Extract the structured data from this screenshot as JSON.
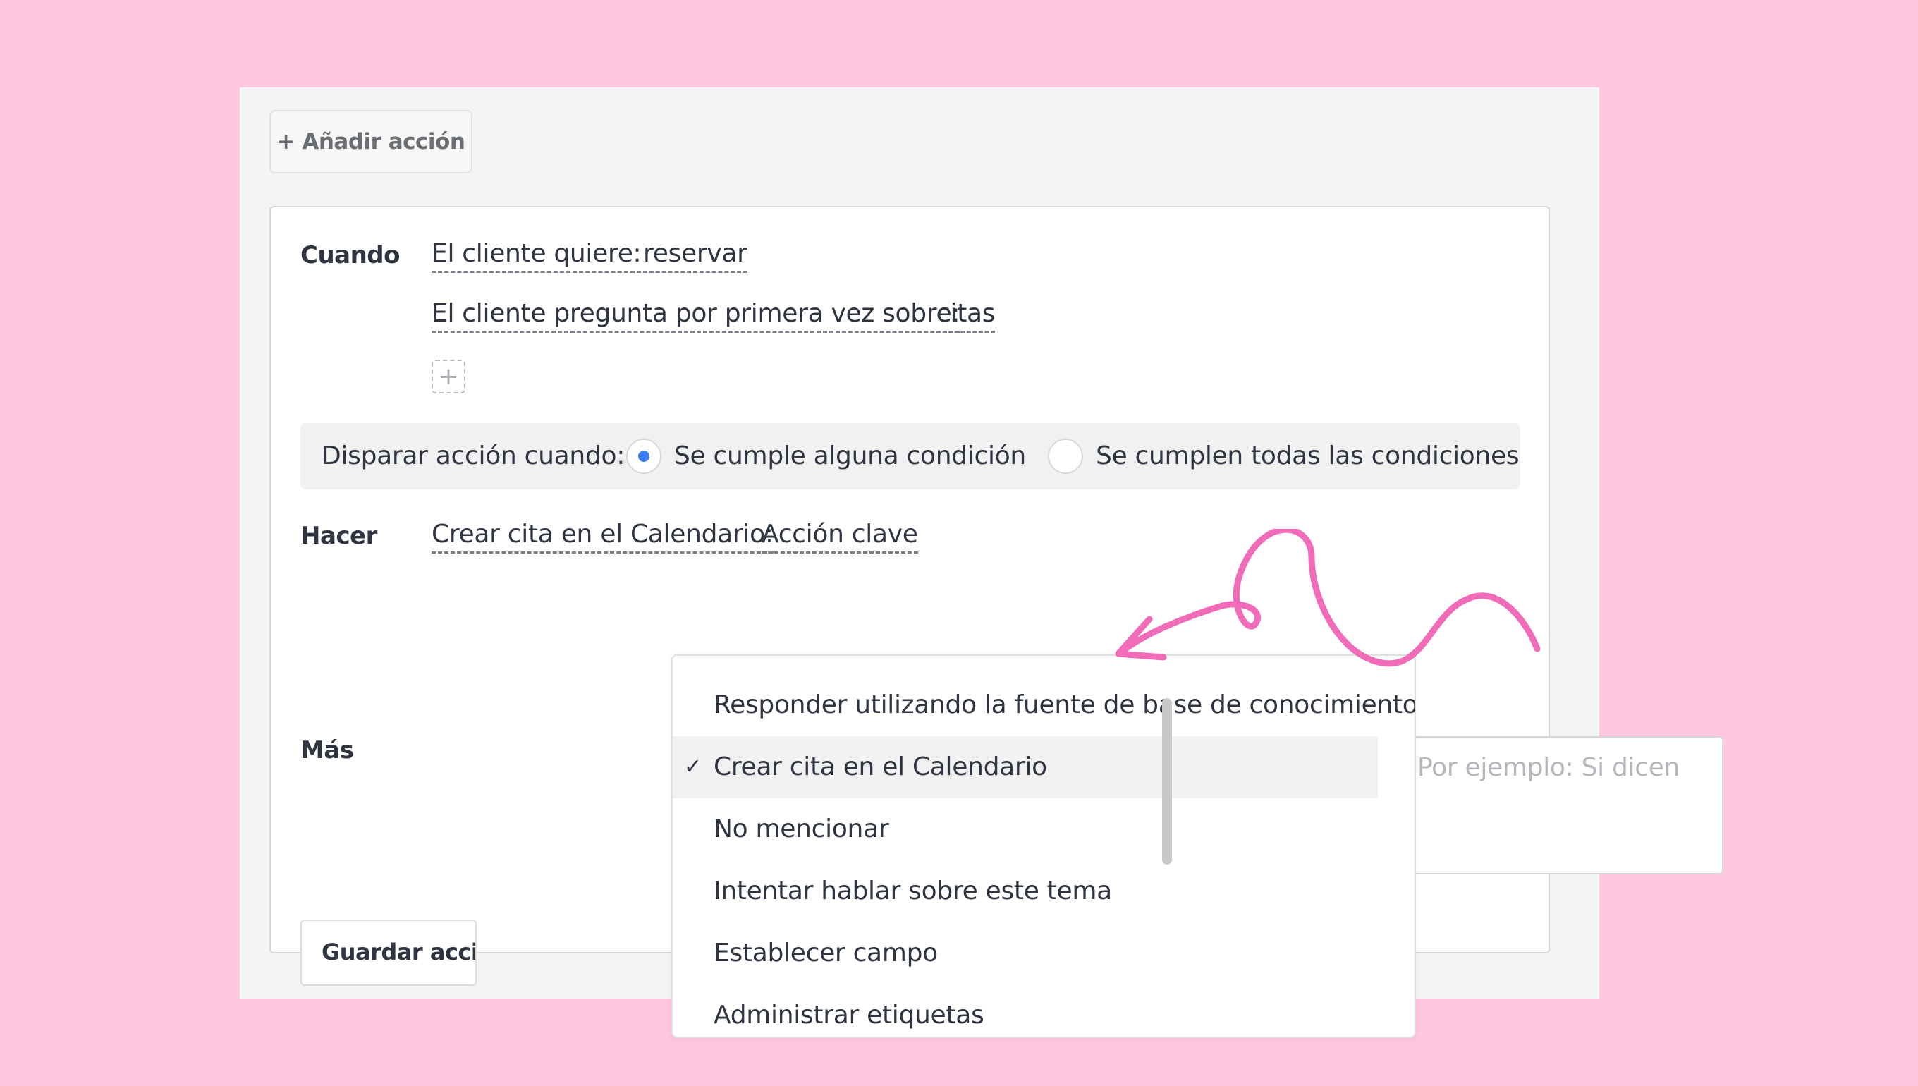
{
  "colors": {
    "background": "#ffc8e0",
    "accent_radio": "#3b7cf0",
    "annotation_arrow": "#f06cb8"
  },
  "toolbar": {
    "add_action_label": "+ Añadir acción"
  },
  "rule": {
    "when_label": "Cuando",
    "conditions": [
      {
        "field": "El cliente quiere:",
        "value": "reservar"
      },
      {
        "field": "El cliente pregunta por primera vez sobre:",
        "value": "citas"
      }
    ],
    "add_condition_icon": "+",
    "trigger": {
      "label": "Disparar acción cuando:",
      "options": [
        {
          "label": "Se cumple alguna condición",
          "selected": true
        },
        {
          "label": "Se cumplen todas las condiciones",
          "selected": false
        }
      ]
    },
    "do_label": "Hacer",
    "action": {
      "field": "Crear cita en el Calendario:",
      "value": "Acción clave"
    },
    "more_label": "Más",
    "more_placeholder": "Por ejemplo: Si dicen",
    "save_label": "Guardar acción"
  },
  "dropdown": {
    "options": [
      {
        "label": "Responder utilizando la fuente de base de conocimientos",
        "selected": false
      },
      {
        "label": "Crear cita en el Calendario",
        "selected": true
      },
      {
        "label": "No mencionar",
        "selected": false
      },
      {
        "label": "Intentar hablar sobre este tema",
        "selected": false
      },
      {
        "label": "Establecer campo",
        "selected": false
      },
      {
        "label": "Administrar etiquetas",
        "selected": false
      }
    ],
    "check_icon": "✓"
  }
}
